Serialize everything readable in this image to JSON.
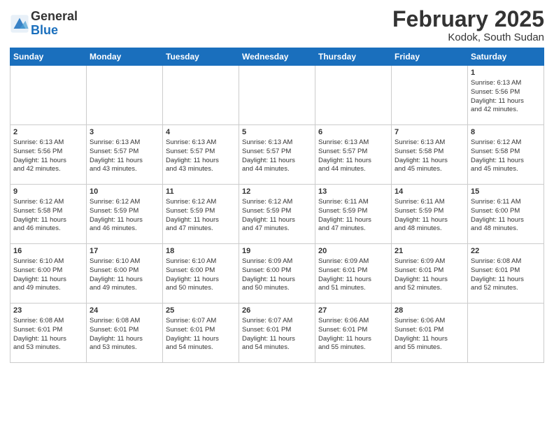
{
  "header": {
    "logo_general": "General",
    "logo_blue": "Blue",
    "month_title": "February 2025",
    "location": "Kodok, South Sudan"
  },
  "days_of_week": [
    "Sunday",
    "Monday",
    "Tuesday",
    "Wednesday",
    "Thursday",
    "Friday",
    "Saturday"
  ],
  "weeks": [
    [
      {
        "day": "",
        "info": ""
      },
      {
        "day": "",
        "info": ""
      },
      {
        "day": "",
        "info": ""
      },
      {
        "day": "",
        "info": ""
      },
      {
        "day": "",
        "info": ""
      },
      {
        "day": "",
        "info": ""
      },
      {
        "day": "1",
        "info": "Sunrise: 6:13 AM\nSunset: 5:56 PM\nDaylight: 11 hours\nand 42 minutes."
      }
    ],
    [
      {
        "day": "2",
        "info": "Sunrise: 6:13 AM\nSunset: 5:56 PM\nDaylight: 11 hours\nand 42 minutes."
      },
      {
        "day": "3",
        "info": "Sunrise: 6:13 AM\nSunset: 5:57 PM\nDaylight: 11 hours\nand 43 minutes."
      },
      {
        "day": "4",
        "info": "Sunrise: 6:13 AM\nSunset: 5:57 PM\nDaylight: 11 hours\nand 43 minutes."
      },
      {
        "day": "5",
        "info": "Sunrise: 6:13 AM\nSunset: 5:57 PM\nDaylight: 11 hours\nand 44 minutes."
      },
      {
        "day": "6",
        "info": "Sunrise: 6:13 AM\nSunset: 5:57 PM\nDaylight: 11 hours\nand 44 minutes."
      },
      {
        "day": "7",
        "info": "Sunrise: 6:13 AM\nSunset: 5:58 PM\nDaylight: 11 hours\nand 45 minutes."
      },
      {
        "day": "8",
        "info": "Sunrise: 6:12 AM\nSunset: 5:58 PM\nDaylight: 11 hours\nand 45 minutes."
      }
    ],
    [
      {
        "day": "9",
        "info": "Sunrise: 6:12 AM\nSunset: 5:58 PM\nDaylight: 11 hours\nand 46 minutes."
      },
      {
        "day": "10",
        "info": "Sunrise: 6:12 AM\nSunset: 5:59 PM\nDaylight: 11 hours\nand 46 minutes."
      },
      {
        "day": "11",
        "info": "Sunrise: 6:12 AM\nSunset: 5:59 PM\nDaylight: 11 hours\nand 47 minutes."
      },
      {
        "day": "12",
        "info": "Sunrise: 6:12 AM\nSunset: 5:59 PM\nDaylight: 11 hours\nand 47 minutes."
      },
      {
        "day": "13",
        "info": "Sunrise: 6:11 AM\nSunset: 5:59 PM\nDaylight: 11 hours\nand 47 minutes."
      },
      {
        "day": "14",
        "info": "Sunrise: 6:11 AM\nSunset: 5:59 PM\nDaylight: 11 hours\nand 48 minutes."
      },
      {
        "day": "15",
        "info": "Sunrise: 6:11 AM\nSunset: 6:00 PM\nDaylight: 11 hours\nand 48 minutes."
      }
    ],
    [
      {
        "day": "16",
        "info": "Sunrise: 6:10 AM\nSunset: 6:00 PM\nDaylight: 11 hours\nand 49 minutes."
      },
      {
        "day": "17",
        "info": "Sunrise: 6:10 AM\nSunset: 6:00 PM\nDaylight: 11 hours\nand 49 minutes."
      },
      {
        "day": "18",
        "info": "Sunrise: 6:10 AM\nSunset: 6:00 PM\nDaylight: 11 hours\nand 50 minutes."
      },
      {
        "day": "19",
        "info": "Sunrise: 6:09 AM\nSunset: 6:00 PM\nDaylight: 11 hours\nand 50 minutes."
      },
      {
        "day": "20",
        "info": "Sunrise: 6:09 AM\nSunset: 6:01 PM\nDaylight: 11 hours\nand 51 minutes."
      },
      {
        "day": "21",
        "info": "Sunrise: 6:09 AM\nSunset: 6:01 PM\nDaylight: 11 hours\nand 52 minutes."
      },
      {
        "day": "22",
        "info": "Sunrise: 6:08 AM\nSunset: 6:01 PM\nDaylight: 11 hours\nand 52 minutes."
      }
    ],
    [
      {
        "day": "23",
        "info": "Sunrise: 6:08 AM\nSunset: 6:01 PM\nDaylight: 11 hours\nand 53 minutes."
      },
      {
        "day": "24",
        "info": "Sunrise: 6:08 AM\nSunset: 6:01 PM\nDaylight: 11 hours\nand 53 minutes."
      },
      {
        "day": "25",
        "info": "Sunrise: 6:07 AM\nSunset: 6:01 PM\nDaylight: 11 hours\nand 54 minutes."
      },
      {
        "day": "26",
        "info": "Sunrise: 6:07 AM\nSunset: 6:01 PM\nDaylight: 11 hours\nand 54 minutes."
      },
      {
        "day": "27",
        "info": "Sunrise: 6:06 AM\nSunset: 6:01 PM\nDaylight: 11 hours\nand 55 minutes."
      },
      {
        "day": "28",
        "info": "Sunrise: 6:06 AM\nSunset: 6:01 PM\nDaylight: 11 hours\nand 55 minutes."
      },
      {
        "day": "",
        "info": ""
      }
    ]
  ]
}
